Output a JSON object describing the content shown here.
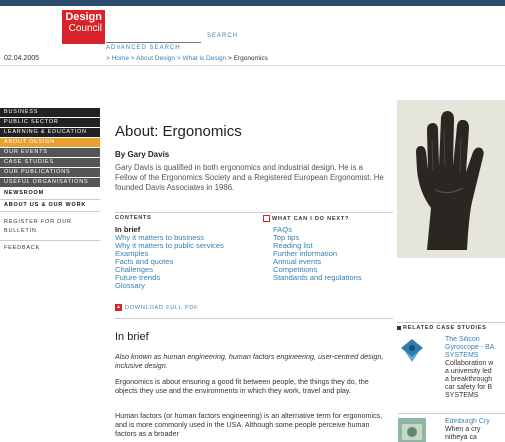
{
  "header": {
    "logo_line1": "Design",
    "logo_line2": "Council",
    "search": {
      "value": "",
      "placeholder": "",
      "button_label": "SEARCH"
    },
    "advanced_search_label": "ADVANCED SEARCH",
    "date": "02.04.2005"
  },
  "breadcrumb": {
    "items": [
      "> Home",
      "> About Design",
      "> What is Design",
      "> Ergonomics"
    ]
  },
  "sidebar": {
    "items": [
      {
        "label": "BUSINESS"
      },
      {
        "label": "PUBLIC SECTOR"
      },
      {
        "label": "LEARNING & EDUCATION"
      },
      {
        "label": "ABOUT DESIGN"
      },
      {
        "label": "OUR EVENTS"
      },
      {
        "label": "CASE STUDIES"
      },
      {
        "label": "OUR PUBLICATIONS"
      },
      {
        "label": "USEFUL ORGANISATIONS"
      },
      {
        "label": "NEWSROOM"
      },
      {
        "label": "ABOUT US & OUR WORK"
      }
    ],
    "register_line1": "REGISTER FOR OUR",
    "register_line2": "BULLETIN",
    "feedback": "FEEDBACK"
  },
  "main": {
    "title": "About: Ergonomics",
    "author": "By Gary Davis",
    "intro": "Gary Davis is qualified in both ergonomics and industrial design. He is a Fellow of the Ergonomics Society and a Registered European Ergonomist. He founded Davis Associates in 1986.",
    "contents_heading": "CONTENTS",
    "contents": [
      "In brief",
      "Why it matters to business",
      "Why it matters to public services",
      "Examples",
      "Facts and quotes",
      "Challenges",
      "Future trends",
      "Glossary"
    ],
    "next_heading": "WHAT CAN I DO NEXT?",
    "next_items": [
      "FAQs",
      "Top tips",
      "Reading list",
      "Further information",
      "Annual events",
      "Competitions",
      "Standards and regulations"
    ],
    "pdf_label": "DOWNLOAD FULL PDF",
    "section_title": "In brief",
    "p1": "Also known as human engineering, human factors engineering, user-centred design, inclusive design.",
    "p2": "Ergonomics is about ensuring a good fit between people, the things they do, the objects they use and the environments in which they work, travel and play.",
    "p3": "Human factors (or human factors engineering) is an alternative term for ergonomics, and is more commonly used in the USA. Although some people perceive human factors as a broader"
  },
  "related": {
    "heading": "RELATED CASE STUDIES",
    "cases": [
      {
        "title_lines": [
          "The Silicon",
          "Gyroscope - BA",
          "SYSTEMS"
        ],
        "desc_lines": [
          "Collaboration w",
          "a university led",
          "a breakthrough",
          "car safety for B",
          "SYSTEMS"
        ]
      },
      {
        "title_lines": [
          "Edinburgh Cry"
        ],
        "desc_lines": [
          "When a cry",
          "nitheya ca"
        ]
      }
    ]
  },
  "colors": {
    "brand_red": "#d8232a",
    "link_blue": "#3a7fb0",
    "active_nav": "#e8a030",
    "nav_dark": "#222222"
  }
}
